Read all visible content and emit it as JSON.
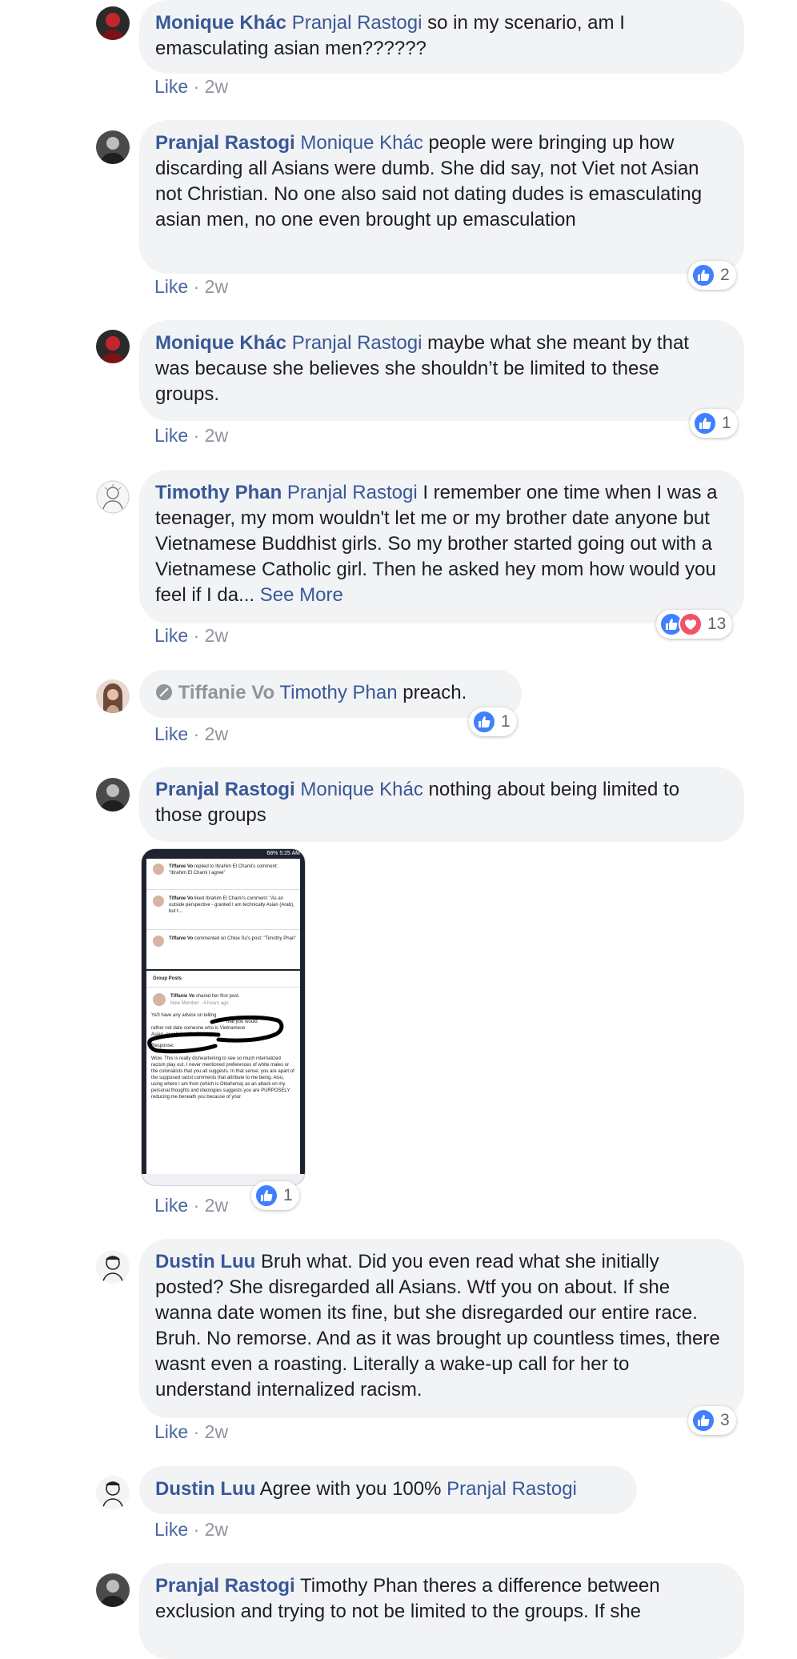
{
  "comments": [
    {
      "author": "Monique Khác",
      "mention": "Pranjal Rastogi",
      "text": " so in my scenario, am I emasculating asian men??????",
      "like": "Like",
      "time": "2w"
    },
    {
      "author": "Pranjal Rastogi",
      "mention": "Monique Khác",
      "text": " people were bringing up how discarding all Asians were dumb. She did say, not Viet not Asian not Christian. No one also said not dating dudes is emasculating asian men, no one even brought up emasculation",
      "like": "Like",
      "time": "2w",
      "reactions": "2"
    },
    {
      "author": "Monique Khác",
      "mention": "Pranjal Rastogi",
      "text": " maybe what she meant by that was because she believes she shouldn’t be limited to these groups.",
      "like": "Like",
      "time": "2w",
      "reactions": "1"
    },
    {
      "author": "Timothy Phan",
      "mention": "Pranjal Rastogi",
      "text": " I remember one time when I was a teenager, my mom wouldn't let me or my brother date anyone but Vietnamese Buddhist girls. So my brother started going out with a Vietnamese Catholic girl. Then he asked hey mom how would you feel if I da...",
      "see_more": "See More",
      "like": "Like",
      "time": "2w",
      "reactions": "13"
    },
    {
      "author": "Tiffanie Vo",
      "mention": "Timothy Phan",
      "text": " preach.",
      "like": "Like",
      "time": "2w",
      "reactions": "1"
    },
    {
      "author": "Pranjal Rastogi",
      "mention": "Monique Khác",
      "text": " nothing about being limited to those groups",
      "like": "Like",
      "time": "2w",
      "reactions": "1"
    },
    {
      "author": "Dustin Luu",
      "text": " Bruh what. Did you even read what she initially posted? She disregarded all Asians. Wtf you on about. If she wanna date women its fine, but she disregarded our entire race. Bruh. No remorse. And as it was brought up countless times, there wasnt even a roasting. Literally a wake-up call for her to understand internalized racism.",
      "like": "Like",
      "time": "2w",
      "reactions": "3"
    },
    {
      "author": "Dustin Luu",
      "text": " Agree with you 100% ",
      "mention": "Pranjal Rastogi",
      "like": "Like",
      "time": "2w"
    },
    {
      "author": "Pranjal Rastogi",
      "text": " Timothy Phan theres a difference between exclusion and trying to not be limited to the groups. If she"
    }
  ],
  "dot": " · ",
  "screenshot": {
    "status": "68% 5:25 AM",
    "notif1_name": "Tiffanie Vo",
    "notif1_text": " replied to Ibrahim El Chami's comment: \"Ibrahim El Chami I agree\"",
    "notif2_name": "Tiffanie Vo",
    "notif2_text": " liked Ibrahim El Chami's comment: \"As an outside perspective - granted I am technically Asian (Arab), but t...",
    "notif3_name": "Tiffanie Vo",
    "notif3_text": " commented on Chloe Su's post: \"Timothy Phan\"",
    "group_posts": "Group Posts",
    "post_author": "Tiffanie Vo",
    "post_action": " shared her first post.",
    "post_sub": "New Member · 4 hours ago",
    "post_line1": "Ya'll have any advice on telling",
    "post_line2": "that you would",
    "post_line3": "rather not date someone who is Vietnamese",
    "post_line4": "Asian, or religious? LOL #fighty",
    "response": "Response:",
    "body": "Wow. This is really disheartening to see so much internalized racism play out. I never mentioned preferences of white males or the colonialists that you all suggests. In that sense, you are apart of the supposed racist comments that attribute to me being. Also, using where I am from (which is Oklahoma) as an attack on my personal thoughts and ideologies suggests you are PURPOSELY reducing me beneath you because of your"
  },
  "colors": {
    "link": "#385898",
    "bubble": "#f2f3f5",
    "like_blue": "#4080ff",
    "love_red": "#f25268"
  }
}
